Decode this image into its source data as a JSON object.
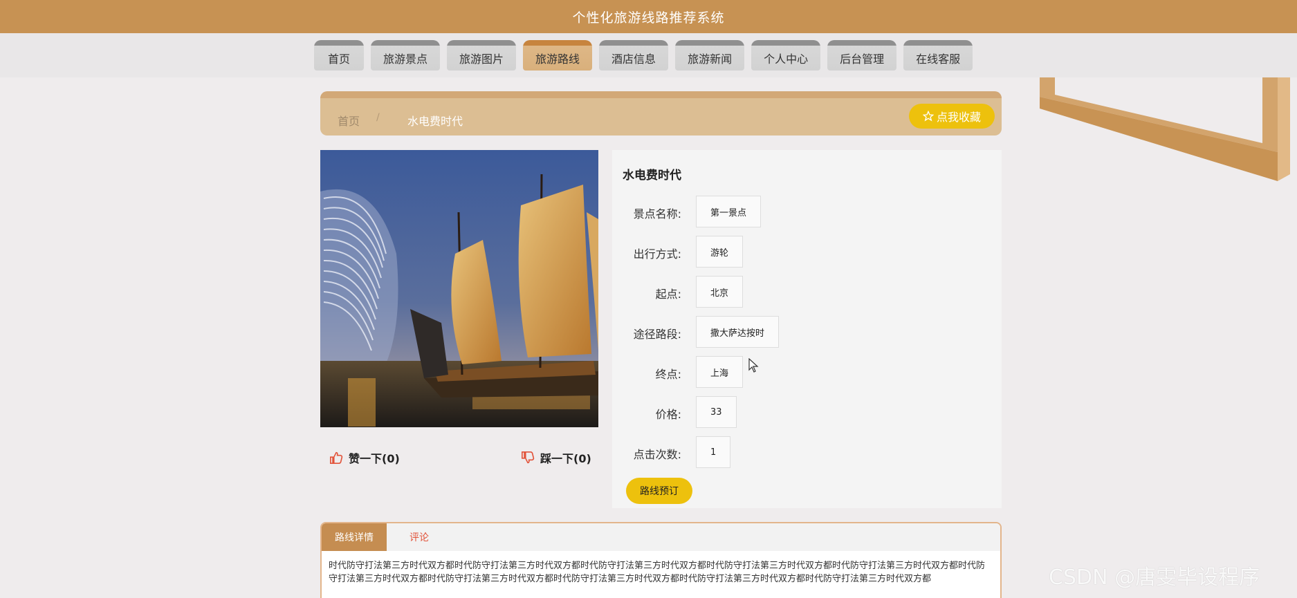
{
  "app": {
    "title": "个性化旅游线路推荐系统"
  },
  "nav": {
    "items": [
      "首页",
      "旅游景点",
      "旅游图片",
      "旅游路线",
      "酒店信息",
      "旅游新闻",
      "个人中心",
      "后台管理",
      "在线客服"
    ],
    "active": "旅游路线"
  },
  "breadcrumb": {
    "home": "首页",
    "separator": "/",
    "current": "水电费时代"
  },
  "favorite": {
    "icon": "star-icon",
    "label": "点我收藏"
  },
  "votes": {
    "like": "赞一下(0)",
    "dislike": "踩一下(0)",
    "like_icon": "thumbs-up-icon",
    "dislike_icon": "thumbs-down-icon"
  },
  "route": {
    "title": "水电费时代",
    "fields": [
      {
        "label": "景点名称:",
        "value": "第一景点"
      },
      {
        "label": "出行方式:",
        "value": "游轮"
      },
      {
        "label": "起点:",
        "value": "北京"
      },
      {
        "label": "途径路段:",
        "value": "撒大萨达按时"
      },
      {
        "label": "终点:",
        "value": "上海"
      },
      {
        "label": "价格:",
        "value": "33"
      },
      {
        "label": "点击次数:",
        "value": "1"
      }
    ],
    "book_label": "路线预订"
  },
  "tabs": {
    "detail": "路线详情",
    "comments": "评论"
  },
  "detail_text": "时代防守打法第三方时代双方都时代防守打法第三方时代双方都时代防守打法第三方时代双方都时代防守打法第三方时代双方都时代防守打法第三方时代双方都时代防守打法第三方时代双方都时代防守打法第三方时代双方都时代防守打法第三方时代双方都时代防守打法第三方时代双方都时代防守打法第三方时代双方都",
  "watermark": "CSDN @唐雯毕设程序",
  "colors": {
    "header": "#c79253",
    "accent_yellow": "#edc10d",
    "active_tab": "#c58d51"
  }
}
